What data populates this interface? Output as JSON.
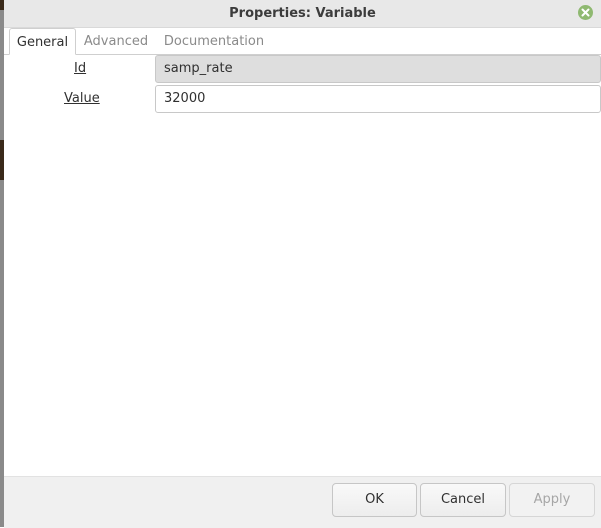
{
  "window": {
    "title": "Properties: Variable"
  },
  "tabs": [
    {
      "label": "General",
      "active": true
    },
    {
      "label": "Advanced",
      "active": false
    },
    {
      "label": "Documentation",
      "active": false
    }
  ],
  "fields": {
    "id": {
      "label": "Id",
      "value": "samp_rate"
    },
    "value": {
      "label": "Value",
      "value": "32000"
    }
  },
  "buttons": {
    "ok": "OK",
    "cancel": "Cancel",
    "apply": "Apply"
  },
  "colors": {
    "close_button": "#8fb971",
    "titlebar": "#e8e8e8",
    "readonly_field": "#dedede"
  },
  "icons": {
    "close": "close-icon"
  }
}
